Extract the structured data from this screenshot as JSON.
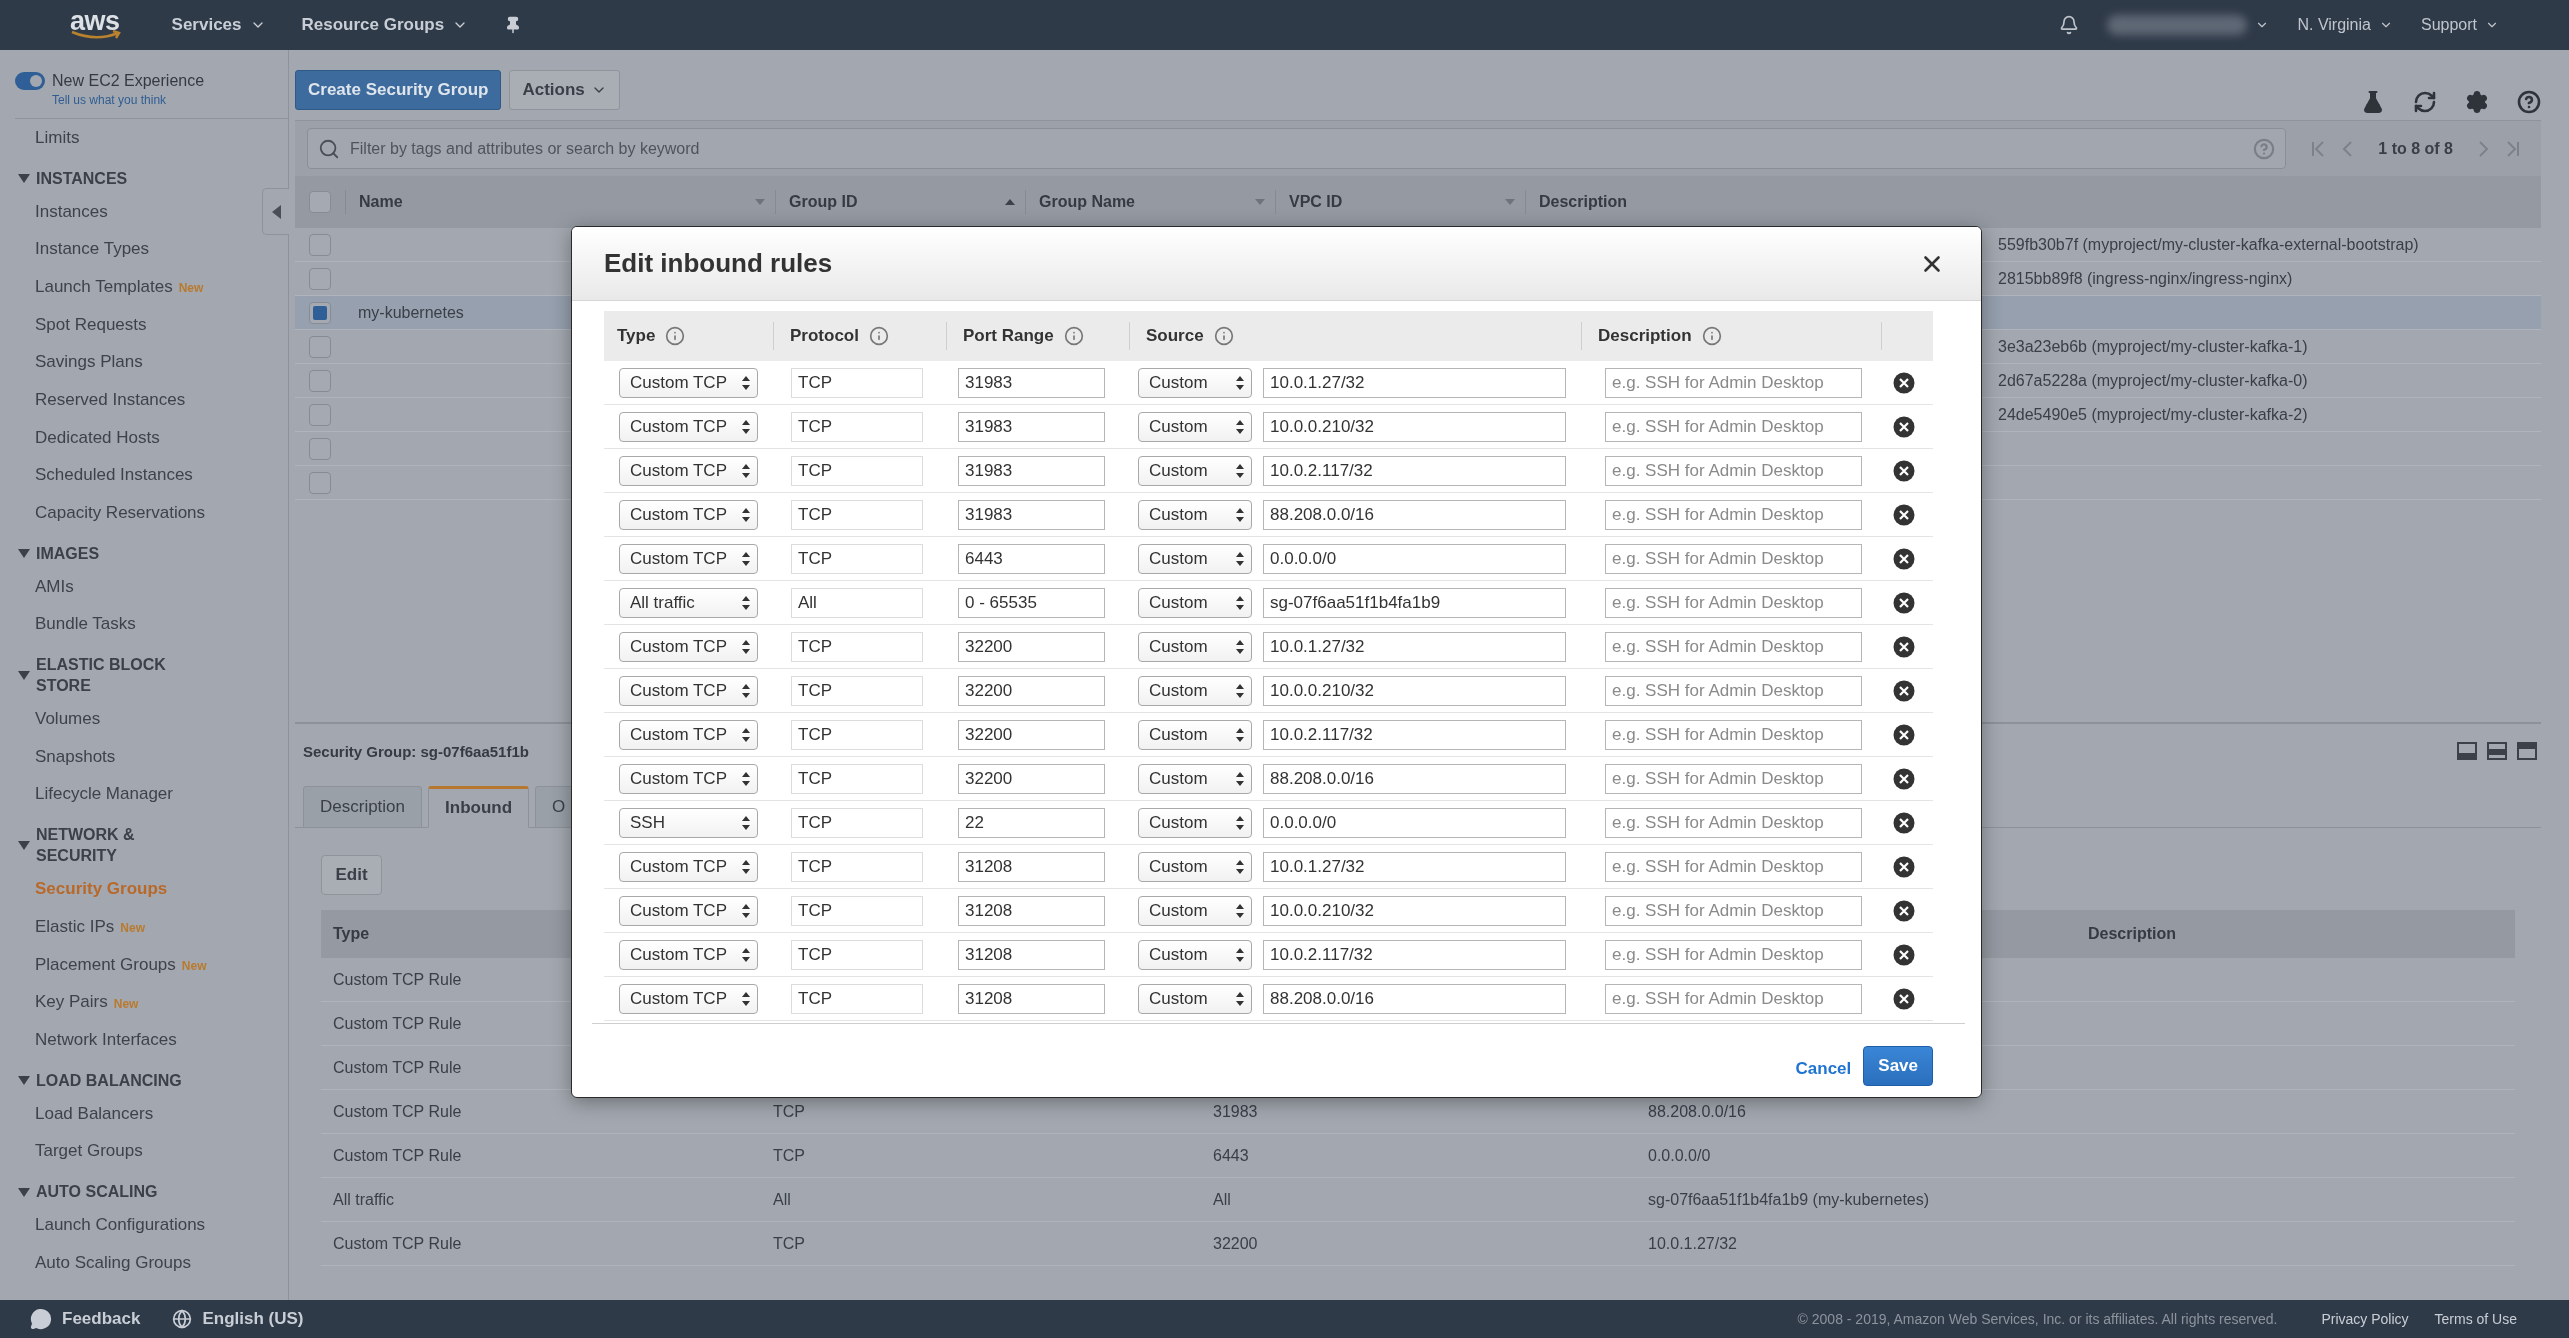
{
  "top_nav": {
    "logo": "aws",
    "menus": [
      "Services",
      "Resource Groups"
    ],
    "region": "N. Virginia",
    "support": "Support"
  },
  "sidebar": {
    "experience": {
      "label": "New EC2 Experience",
      "on": true,
      "link": "Tell us what you think"
    },
    "top_items": [
      {
        "label": "Limits",
        "selected": false
      }
    ],
    "sections": [
      {
        "title": "INSTANCES",
        "expanded": true,
        "items": [
          {
            "label": "Instances",
            "selected": false
          },
          {
            "label": "Instance Types",
            "selected": false
          },
          {
            "label": "Launch Templates",
            "badge": "New",
            "selected": false
          },
          {
            "label": "Spot Requests",
            "selected": false
          },
          {
            "label": "Savings Plans",
            "selected": false
          },
          {
            "label": "Reserved Instances",
            "selected": false
          },
          {
            "label": "Dedicated Hosts",
            "selected": false
          },
          {
            "label": "Scheduled Instances",
            "selected": false
          },
          {
            "label": "Capacity Reservations",
            "selected": false
          }
        ]
      },
      {
        "title": "IMAGES",
        "expanded": true,
        "items": [
          {
            "label": "AMIs",
            "selected": false
          },
          {
            "label": "Bundle Tasks",
            "selected": false
          }
        ]
      },
      {
        "title": "ELASTIC BLOCK STORE",
        "expanded": true,
        "items": [
          {
            "label": "Volumes",
            "selected": false
          },
          {
            "label": "Snapshots",
            "selected": false
          },
          {
            "label": "Lifecycle Manager",
            "selected": false
          }
        ]
      },
      {
        "title": "NETWORK & SECURITY",
        "expanded": true,
        "items": [
          {
            "label": "Security Groups",
            "selected": true
          },
          {
            "label": "Elastic IPs",
            "badge": "New",
            "selected": false
          },
          {
            "label": "Placement Groups",
            "badge": "New",
            "selected": false
          },
          {
            "label": "Key Pairs",
            "badge": "New",
            "selected": false
          },
          {
            "label": "Network Interfaces",
            "selected": false
          }
        ]
      },
      {
        "title": "LOAD BALANCING",
        "expanded": true,
        "items": [
          {
            "label": "Load Balancers",
            "selected": false
          },
          {
            "label": "Target Groups",
            "selected": false
          }
        ]
      },
      {
        "title": "AUTO SCALING",
        "expanded": true,
        "items": [
          {
            "label": "Launch Configurations",
            "selected": false
          },
          {
            "label": "Auto Scaling Groups",
            "selected": false
          }
        ]
      }
    ]
  },
  "toolbar": {
    "create_button": "Create Security Group",
    "actions_button": "Actions"
  },
  "filter": {
    "placeholder": "Filter by tags and attributes or search by keyword"
  },
  "pagination": "1 to 8 of 8",
  "groups_table": {
    "select_all_checked": false,
    "columns": [
      {
        "label": "Name",
        "menu": true
      },
      {
        "label": "Group ID",
        "sorted": true
      },
      {
        "label": "Group Name",
        "menu": true
      },
      {
        "label": "VPC ID",
        "menu": true
      },
      {
        "label": "Description"
      }
    ],
    "rows": [
      {
        "selected": false,
        "description": "559fb30b7f (myproject/my-cluster-kafka-external-bootstrap)"
      },
      {
        "selected": false,
        "description": "2815bb89f8 (ingress-nginx/ingress-nginx)"
      },
      {
        "selected": true,
        "name": "my-kubernetes"
      },
      {
        "selected": false,
        "description": "3e3a23eb6b (myproject/my-cluster-kafka-1)"
      },
      {
        "selected": false,
        "description": "2d67a5228a (myproject/my-cluster-kafka-0)"
      },
      {
        "selected": false,
        "description": "24de5490e5 (myproject/my-cluster-kafka-2)"
      },
      {
        "selected": false
      },
      {
        "selected": false
      }
    ]
  },
  "details": {
    "title": "Security Group: sg-07f6aa51f1b",
    "tabs": [
      {
        "label": "Description",
        "selected": false
      },
      {
        "label": "Inbound",
        "selected": true
      },
      {
        "label": "O",
        "selected": false
      }
    ],
    "edit_button": "Edit",
    "rules_header": {
      "type": "Type",
      "description": "Description"
    },
    "rules": [
      {
        "type": "Custom TCP Rule"
      },
      {
        "type": "Custom TCP Rule"
      },
      {
        "type": "Custom TCP Rule"
      },
      {
        "type": "Custom TCP Rule",
        "protocol": "TCP",
        "port_range": "31983",
        "source": "88.208.0.0/16"
      },
      {
        "type": "Custom TCP Rule",
        "protocol": "TCP",
        "port_range": "6443",
        "source": "0.0.0.0/0"
      },
      {
        "type": "All traffic",
        "protocol": "All",
        "port_range": "All",
        "source": "sg-07f6aa51f1b4fa1b9 (my-kubernetes)"
      },
      {
        "type": "Custom TCP Rule",
        "protocol": "TCP",
        "port_range": "32200",
        "source": "10.0.1.27/32"
      }
    ]
  },
  "modal": {
    "title": "Edit inbound rules",
    "columns": [
      "Type",
      "Protocol",
      "Port Range",
      "Source",
      "Description"
    ],
    "rows": [
      {
        "type": "Custom TCP",
        "protocol": "TCP",
        "port_range": "31983",
        "source_type": "Custom",
        "source": "10.0.1.27/32",
        "description_placeholder": "e.g. SSH for Admin Desktop"
      },
      {
        "type": "Custom TCP",
        "protocol": "TCP",
        "port_range": "31983",
        "source_type": "Custom",
        "source": "10.0.0.210/32",
        "description_placeholder": "e.g. SSH for Admin Desktop"
      },
      {
        "type": "Custom TCP",
        "protocol": "TCP",
        "port_range": "31983",
        "source_type": "Custom",
        "source": "10.0.2.117/32",
        "description_placeholder": "e.g. SSH for Admin Desktop"
      },
      {
        "type": "Custom TCP",
        "protocol": "TCP",
        "port_range": "31983",
        "source_type": "Custom",
        "source": "88.208.0.0/16",
        "description_placeholder": "e.g. SSH for Admin Desktop"
      },
      {
        "type": "Custom TCP",
        "protocol": "TCP",
        "port_range": "6443",
        "source_type": "Custom",
        "source": "0.0.0.0/0",
        "description_placeholder": "e.g. SSH for Admin Desktop"
      },
      {
        "type": "All traffic",
        "protocol": "All",
        "port_range": "0 - 65535",
        "source_type": "Custom",
        "source": "sg-07f6aa51f1b4fa1b9",
        "description_placeholder": "e.g. SSH for Admin Desktop"
      },
      {
        "type": "Custom TCP",
        "protocol": "TCP",
        "port_range": "32200",
        "source_type": "Custom",
        "source": "10.0.1.27/32",
        "description_placeholder": "e.g. SSH for Admin Desktop"
      },
      {
        "type": "Custom TCP",
        "protocol": "TCP",
        "port_range": "32200",
        "source_type": "Custom",
        "source": "10.0.0.210/32",
        "description_placeholder": "e.g. SSH for Admin Desktop"
      },
      {
        "type": "Custom TCP",
        "protocol": "TCP",
        "port_range": "32200",
        "source_type": "Custom",
        "source": "10.0.2.117/32",
        "description_placeholder": "e.g. SSH for Admin Desktop"
      },
      {
        "type": "Custom TCP",
        "protocol": "TCP",
        "port_range": "32200",
        "source_type": "Custom",
        "source": "88.208.0.0/16",
        "description_placeholder": "e.g. SSH for Admin Desktop"
      },
      {
        "type": "SSH",
        "protocol": "TCP",
        "port_range": "22",
        "source_type": "Custom",
        "source": "0.0.0.0/0",
        "description_placeholder": "e.g. SSH for Admin Desktop"
      },
      {
        "type": "Custom TCP",
        "protocol": "TCP",
        "port_range": "31208",
        "source_type": "Custom",
        "source": "10.0.1.27/32",
        "description_placeholder": "e.g. SSH for Admin Desktop"
      },
      {
        "type": "Custom TCP",
        "protocol": "TCP",
        "port_range": "31208",
        "source_type": "Custom",
        "source": "10.0.0.210/32",
        "description_placeholder": "e.g. SSH for Admin Desktop"
      },
      {
        "type": "Custom TCP",
        "protocol": "TCP",
        "port_range": "31208",
        "source_type": "Custom",
        "source": "10.0.2.117/32",
        "description_placeholder": "e.g. SSH for Admin Desktop"
      },
      {
        "type": "Custom TCP",
        "protocol": "TCP",
        "port_range": "31208",
        "source_type": "Custom",
        "source": "88.208.0.0/16",
        "description_placeholder": "e.g. SSH for Admin Desktop"
      }
    ],
    "cancel": "Cancel",
    "save": "Save"
  },
  "footer": {
    "feedback": "Feedback",
    "language": "English (US)",
    "copyright": "© 2008 - 2019, Amazon Web Services, Inc. or its affiliates. All rights reserved.",
    "links": [
      "Privacy Policy",
      "Terms of Use"
    ]
  }
}
